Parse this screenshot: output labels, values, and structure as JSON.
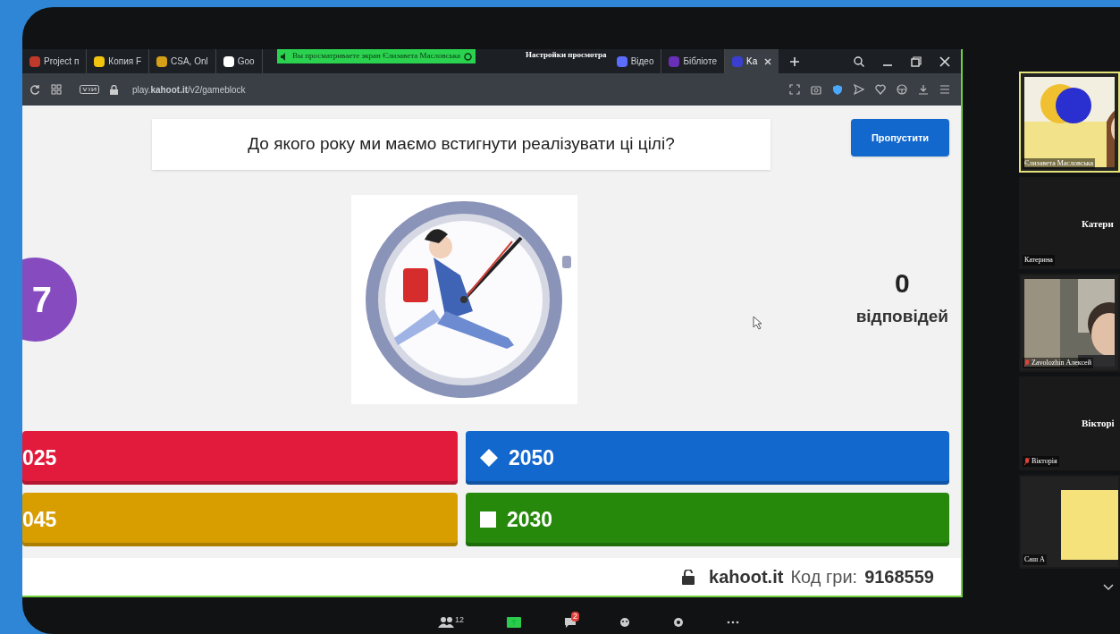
{
  "browser": {
    "tabs": [
      {
        "label": "Project п",
        "selected": false,
        "color": "#c0392b"
      },
      {
        "label": "Копия F",
        "selected": false,
        "color": "#f1c40f"
      },
      {
        "label": "CSA, Onl",
        "selected": false,
        "color": "#d4a017"
      },
      {
        "label": "Goo",
        "selected": false,
        "color": "#ffffff"
      },
      {
        "label": "Відео",
        "selected": false,
        "color": "#5b6cff"
      },
      {
        "label": "Бібліоте",
        "selected": false,
        "color": "#6a2fb8"
      },
      {
        "label": "Ka",
        "selected": true,
        "color": "#3a3fd0"
      }
    ],
    "url": "play.**kahoot.it**/v2/gameblock"
  },
  "share_banner": {
    "text": "Вы просматриваете экран Єлизавета Масловська",
    "options": "Настройки просмотра"
  },
  "quiz": {
    "question": "До якого року ми маємо встигнути реалізувати ці цілі?",
    "skip_button": "Пропустити",
    "timer": "7",
    "answers_count": "0",
    "answers_label": "відповідей",
    "answers": [
      {
        "text": "025",
        "color": "#e21b3c"
      },
      {
        "text": "2050",
        "color": "#1368ce",
        "kind": "diamond"
      },
      {
        "text": "045",
        "color": "#d89e00"
      },
      {
        "text": "2030",
        "color": "#26890c",
        "kind": "square"
      }
    ]
  },
  "footer": {
    "host": "kahoot.it",
    "code_label": "Код гри:",
    "code": "9168559"
  },
  "participants": [
    {
      "kind": "video",
      "name": "Єлизавета Масловська",
      "active": true,
      "muted": false
    },
    {
      "kind": "name",
      "display": "Катери",
      "name": "Катерина",
      "active": false,
      "muted": false
    },
    {
      "kind": "video",
      "name": "Zavolozhin Алексей",
      "active": false,
      "muted": true
    },
    {
      "kind": "name",
      "display": "Вікторі",
      "name": "Вікторія",
      "active": false,
      "muted": true
    },
    {
      "kind": "avatar",
      "name": "Саш А",
      "active": false,
      "muted": false
    }
  ],
  "toolbar": {
    "participants_count": "12",
    "chat_badge": "2"
  }
}
